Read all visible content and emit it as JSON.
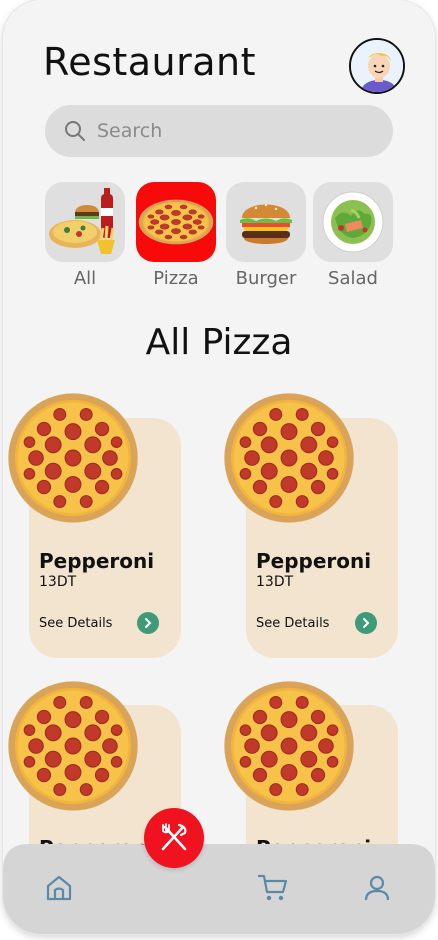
{
  "header": {
    "title": "Restaurant"
  },
  "search": {
    "placeholder": "Search"
  },
  "categories": [
    {
      "label": "All",
      "active": false
    },
    {
      "label": "Pizza",
      "active": true
    },
    {
      "label": "Burger",
      "active": false
    },
    {
      "label": "Salad",
      "active": false
    }
  ],
  "section_title": "All Pizza",
  "products": [
    {
      "name": "Pepperoni",
      "price": "13DT",
      "details_label": "See Details"
    },
    {
      "name": "Pepperoni",
      "price": "13DT",
      "details_label": "See Details"
    },
    {
      "name": "Pepperoni",
      "price": "",
      "details_label": ""
    },
    {
      "name": "Pepperoni",
      "price": "",
      "details_label": ""
    }
  ],
  "bottom_nav": {
    "items": [
      {
        "icon": "home-icon"
      },
      {
        "icon": "cart-icon"
      },
      {
        "icon": "profile-icon"
      }
    ],
    "fab_icon": "fork-knife-icon"
  },
  "colors": {
    "background": "#f4f4f4",
    "search_bg": "#dcdcdc",
    "active_category": "#f90a0a",
    "card_bg": "#f3e4cf",
    "details_button": "#3f9a7a",
    "fab": "#f0121e",
    "nav_bg": "#d5d5d5"
  }
}
